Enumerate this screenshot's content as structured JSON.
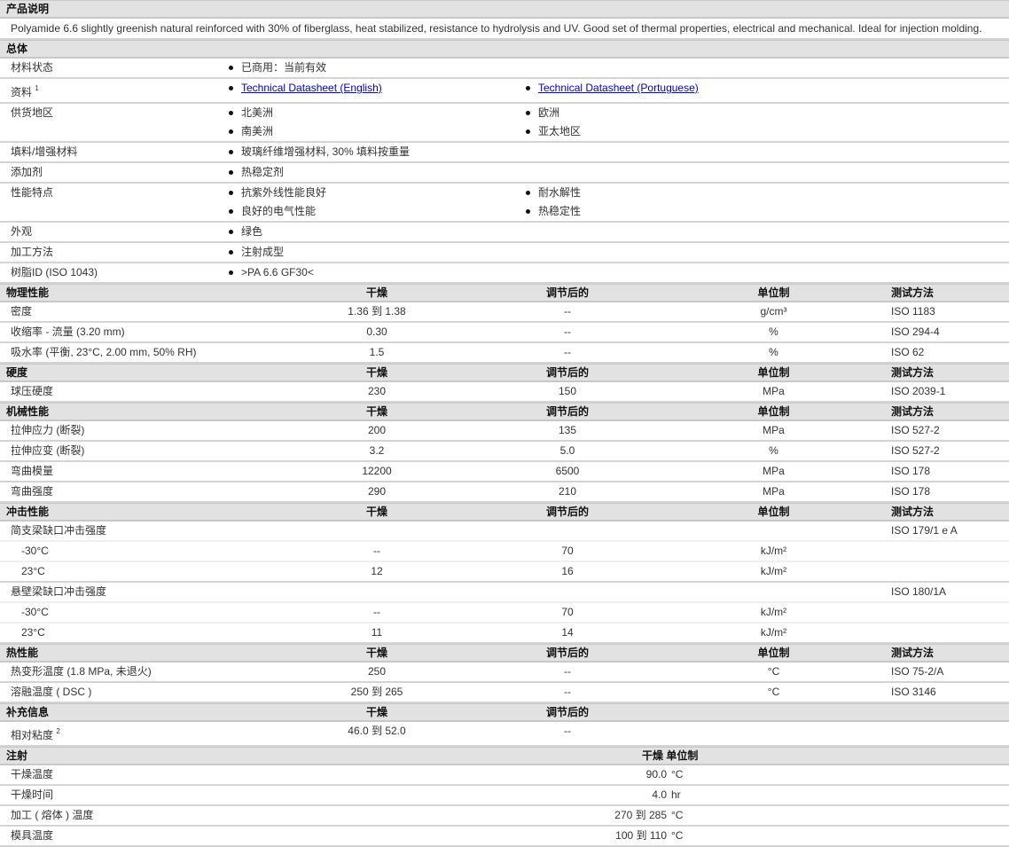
{
  "description": {
    "title": "产品说明",
    "text": "Polyamide 6.6 slightly greenish natural reinforced with 30% of fiberglass, heat stabilized, resistance to hydrolysis and UV. Good set of thermal properties, electrical and mechanical. Ideal for injection molding."
  },
  "general": {
    "title": "总体",
    "rows": [
      {
        "label": "材料状态",
        "col1": [
          "已商用：当前有效"
        ],
        "col2": []
      },
      {
        "label": "资料",
        "sup": "1",
        "col1": [
          "Technical Datasheet (English)"
        ],
        "col2": [
          "Technical Datasheet (Portuguese)"
        ],
        "links": true
      },
      {
        "label": "供货地区",
        "col1": [
          "北美洲",
          "南美洲"
        ],
        "col2": [
          "欧洲",
          "亚太地区"
        ]
      },
      {
        "label": "填料/增强材料",
        "col1": [
          "玻璃纤维增强材料, 30% 填料按重量"
        ],
        "col2": []
      },
      {
        "label": "添加剂",
        "col1": [
          "热稳定剂"
        ],
        "col2": []
      },
      {
        "label": "性能特点",
        "col1": [
          "抗紫外线性能良好",
          "良好的电气性能"
        ],
        "col2": [
          "耐水解性",
          "热稳定性"
        ]
      },
      {
        "label": "外观",
        "col1": [
          "绿色"
        ],
        "col2": []
      },
      {
        "label": "加工方法",
        "col1": [
          "注射成型"
        ],
        "col2": []
      },
      {
        "label": "树脂ID (ISO 1043)",
        "col1": [
          ">PA 6.6 GF30<"
        ],
        "col2": []
      }
    ]
  },
  "sections": [
    {
      "title": "物理性能",
      "headers": [
        "干燥",
        "调节后的",
        "单位制",
        "测试方法"
      ],
      "rows": [
        {
          "label": "密度",
          "dry": "1.36 到 1.38",
          "cond": "--",
          "unit": "g/cm³",
          "method": "ISO 1183"
        },
        {
          "label": "收缩率 - 流量 (3.20 mm)",
          "dry": "0.30",
          "cond": "--",
          "unit": "%",
          "method": "ISO 294-4"
        },
        {
          "label": "吸水率 (平衡, 23°C, 2.00 mm, 50% RH)",
          "dry": "1.5",
          "cond": "--",
          "unit": "%",
          "method": "ISO 62"
        }
      ]
    },
    {
      "title": "硬度",
      "headers": [
        "干燥",
        "调节后的",
        "单位制",
        "测试方法"
      ],
      "rows": [
        {
          "label": "球压硬度",
          "dry": "230",
          "cond": "150",
          "unit": "MPa",
          "method": "ISO 2039-1"
        }
      ]
    },
    {
      "title": "机械性能",
      "headers": [
        "干燥",
        "调节后的",
        "单位制",
        "测试方法"
      ],
      "rows": [
        {
          "label": "拉伸应力 (断裂)",
          "dry": "200",
          "cond": "135",
          "unit": "MPa",
          "method": "ISO 527-2"
        },
        {
          "label": "拉伸应变 (断裂)",
          "dry": "3.2",
          "cond": "5.0",
          "unit": "%",
          "method": "ISO 527-2"
        },
        {
          "label": "弯曲模量",
          "dry": "12200",
          "cond": "6500",
          "unit": "MPa",
          "method": "ISO 178"
        },
        {
          "label": "弯曲强度",
          "dry": "290",
          "cond": "210",
          "unit": "MPa",
          "method": "ISO 178"
        }
      ]
    },
    {
      "title": "冲击性能",
      "headers": [
        "干燥",
        "调节后的",
        "单位制",
        "测试方法"
      ],
      "rows": [
        {
          "label": "简支梁缺口冲击强度",
          "dry": "",
          "cond": "",
          "unit": "",
          "method": "ISO 179/1 e A",
          "sub": true
        },
        {
          "label": "-30°C",
          "dry": "--",
          "cond": "70",
          "unit": "kJ/m²",
          "method": "",
          "indent": true,
          "sub": true
        },
        {
          "label": "23°C",
          "dry": "12",
          "cond": "16",
          "unit": "kJ/m²",
          "method": "",
          "indent": true
        },
        {
          "label": "悬壁梁缺口冲击强度",
          "dry": "",
          "cond": "",
          "unit": "",
          "method": "ISO 180/1A",
          "sub": true
        },
        {
          "label": "-30°C",
          "dry": "--",
          "cond": "70",
          "unit": "kJ/m²",
          "method": "",
          "indent": true,
          "sub": true
        },
        {
          "label": "23°C",
          "dry": "11",
          "cond": "14",
          "unit": "kJ/m²",
          "method": "",
          "indent": true
        }
      ]
    },
    {
      "title": "热性能",
      "headers": [
        "干燥",
        "调节后的",
        "单位制",
        "测试方法"
      ],
      "rows": [
        {
          "label": "热变形温度 (1.8 MPa, 未退火)",
          "dry": "250",
          "cond": "--",
          "unit": "°C",
          "method": "ISO 75-2/A"
        },
        {
          "label": "溶融温度 ( DSC )",
          "dry": "250 到 265",
          "cond": "--",
          "unit": "°C",
          "method": "ISO 3146"
        }
      ]
    },
    {
      "title": "补充信息",
      "headers": [
        "干燥",
        "调节后的",
        "",
        ""
      ],
      "rows": [
        {
          "label": "相对粘度",
          "sup": "2",
          "dry": "46.0 到 52.0",
          "cond": "--",
          "unit": "",
          "method": ""
        }
      ]
    }
  ],
  "injection": {
    "title": "注射",
    "header_value": "干燥",
    "header_unit": "单位制",
    "rows": [
      {
        "label": "干燥温度",
        "value": "90.0",
        "unit": "°C"
      },
      {
        "label": "干燥时间",
        "value": "4.0",
        "unit": "hr"
      },
      {
        "label": "加工 ( 熔体 ) 温度",
        "value": "270 到 285",
        "unit": "°C"
      },
      {
        "label": "模具温度",
        "value": "100 到 110",
        "unit": "°C"
      }
    ]
  }
}
